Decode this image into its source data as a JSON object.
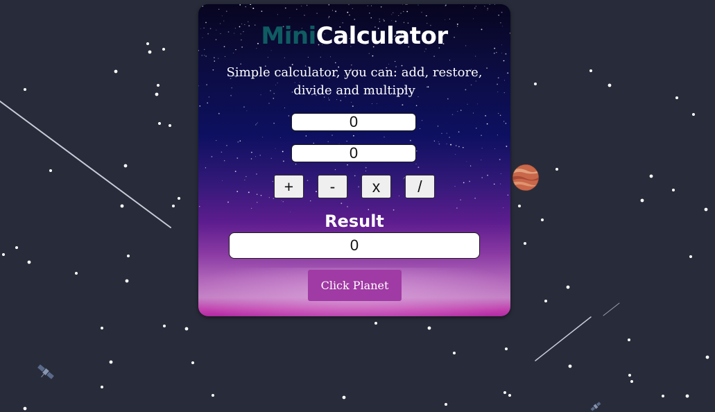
{
  "app": {
    "title_prefix": "Mini",
    "title_main": "Calculator",
    "subtitle": "Simple calculator, you can: add, restore, divide and multiply"
  },
  "inputs": {
    "first_value": "0",
    "second_value": "0"
  },
  "operations": {
    "add_label": "+",
    "subtract_label": "-",
    "multiply_label": "x",
    "divide_label": "/"
  },
  "result": {
    "label": "Result",
    "value": "0"
  },
  "planet_button": {
    "label": "Click Planet"
  },
  "colors": {
    "background": "#282c3a",
    "title_prefix": "#0f5c63",
    "title_main": "#ffffff",
    "planet_button": "#a03aa4",
    "planet": "#c8674a"
  },
  "icons": {
    "planet": "planet-icon",
    "satellite": "satellite-icon",
    "shooting_star": "shooting-star"
  }
}
